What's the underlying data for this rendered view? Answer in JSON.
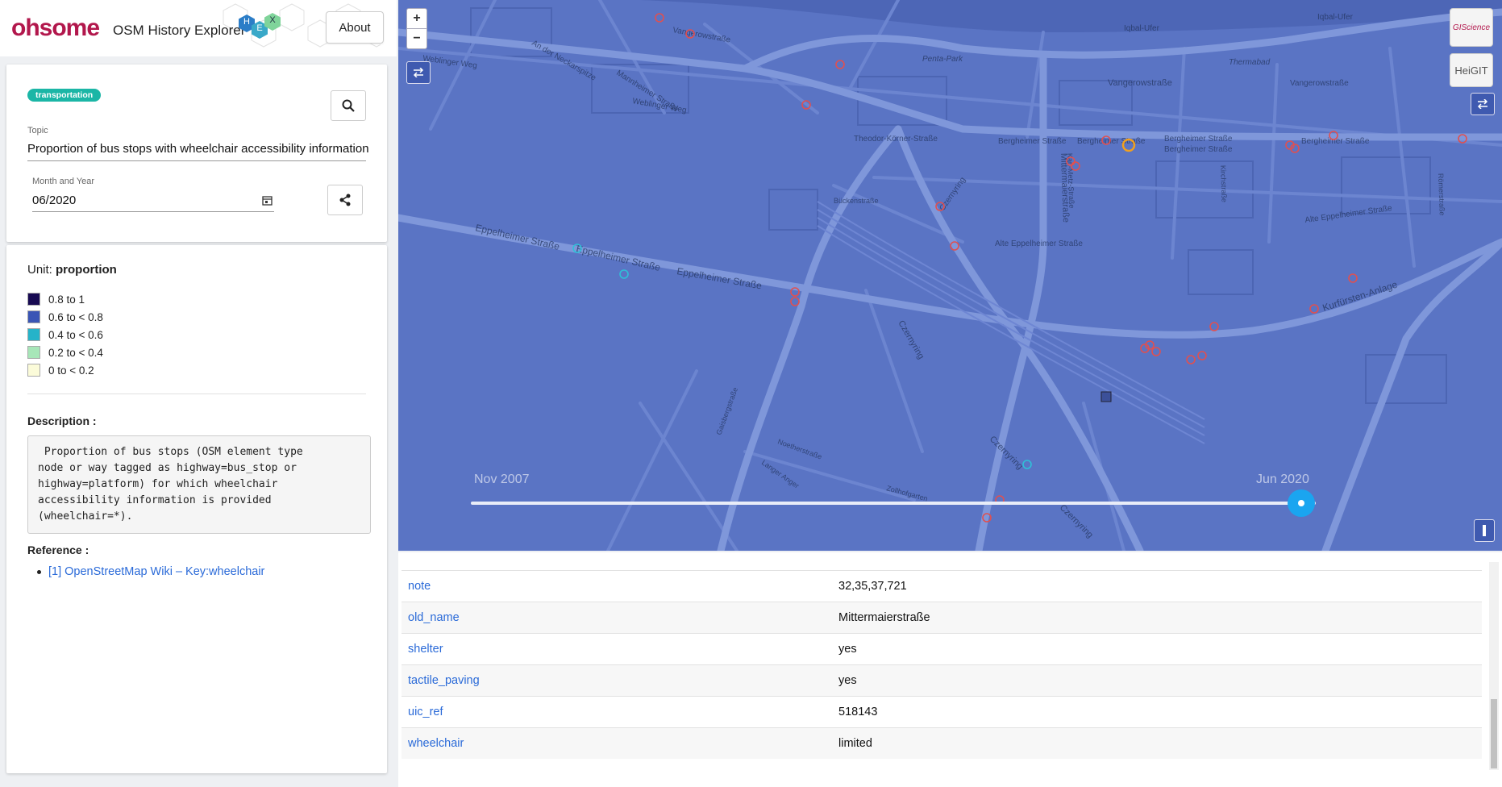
{
  "header": {
    "brand": "ohsome",
    "subtitle": "OSM History Explorer",
    "hex_letters": [
      "H",
      "E",
      "X"
    ],
    "about_label": "About"
  },
  "filter": {
    "tag": "transportation",
    "topic_label": "Topic",
    "topic_value": "Proportion of bus stops with wheelchair accessibility information",
    "date_label": "Month and Year",
    "date_value": "06/2020",
    "search_icon": "search-icon",
    "share_icon": "share-icon",
    "calendar_icon": "calendar-icon"
  },
  "info": {
    "unit_prefix": "Unit:",
    "unit_value": "proportion",
    "legend": [
      {
        "label": "0.8 to 1",
        "color": "#170a52"
      },
      {
        "label": "0.6 to < 0.8",
        "color": "#3a55b5"
      },
      {
        "label": "0.4 to < 0.6",
        "color": "#26b3c9"
      },
      {
        "label": "0.2 to < 0.4",
        "color": "#a7e6b8"
      },
      {
        "label": "0 to < 0.2",
        "color": "#fbfbd9"
      }
    ],
    "description_title": "Description :",
    "description_text": " Proportion of bus stops (OSM element type\nnode or way tagged as highway=bus_stop or\nhighway=platform) for which wheelchair\naccessibility information is provided\n(wheelchair=*).",
    "reference_title": "Reference :",
    "reference_link": "[1] OpenStreetMap Wiki – Key:wheelchair"
  },
  "map": {
    "zoom_in": "+",
    "zoom_out": "−",
    "slider_start": "Nov 2007",
    "slider_end": "Jun 2020",
    "slider_value": 1.0,
    "logo_top": "GIScience",
    "logo_bottom": "HeiGIT",
    "street_labels": [
      "Vangerowstraße",
      "Iqbal-Ufer",
      "Iqbal-Ufer",
      "Penta-Park",
      "Thermabad",
      "Vangerowstraße",
      "Vangerowstraße",
      "Weblinger Weg",
      "Weblinger Weg",
      "An der Neckarspitze",
      "Mannheimer Straße",
      "Theodor-Körner-Straße",
      "Bergheimer Straße",
      "Bergheimer Straße",
      "Bergheimer Straße",
      "Bergheimer Straße",
      "Bergheimer Straße",
      "Mittermaierstraße",
      "Czernyring",
      "Alte Eppelheimer Straße",
      "Alte Eppelheimer Straße",
      "Eppelheimer Straße",
      "Eppelheimer Straße",
      "Eppelheimer Straße",
      "Kurfürsten-Anlage",
      "Czernyring",
      "Czernyring",
      "Czernyring",
      "Bückenstraße",
      "Karl-Metz-Straße",
      "Kirchstraße",
      "Römerstraße",
      "Zollhofgarten",
      "Noetherstraße",
      "Langer Anger",
      "Gaisbergstraße"
    ]
  },
  "attributes": [
    {
      "key": "note",
      "value": "32,35,37,721"
    },
    {
      "key": "old_name",
      "value": "Mittermaierstraße"
    },
    {
      "key": "shelter",
      "value": "yes"
    },
    {
      "key": "tactile_paving",
      "value": "yes"
    },
    {
      "key": "uic_ref",
      "value": "518143"
    },
    {
      "key": "wheelchair",
      "value": "limited"
    }
  ]
}
